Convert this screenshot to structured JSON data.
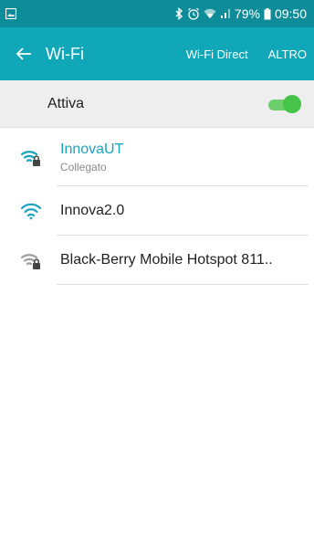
{
  "status_bar": {
    "battery_percent": "79%",
    "time": "09:50",
    "icons": [
      "image-icon",
      "bluetooth-icon",
      "alarm-icon",
      "wifi-status-icon",
      "signal-icon",
      "battery-icon"
    ]
  },
  "app_bar": {
    "title": "Wi-Fi",
    "wifi_direct_label": "Wi-Fi Direct",
    "more_label": "ALTRO"
  },
  "master_switch": {
    "label": "Attiva",
    "on": true
  },
  "networks": [
    {
      "name": "InnovaUT",
      "status": "Collegato",
      "secured": true,
      "connected": true
    },
    {
      "name": "Innova2.0",
      "status": "",
      "secured": false,
      "connected": false
    },
    {
      "name": "Black-Berry Mobile Hotspot 811..",
      "status": "",
      "secured": true,
      "connected": false
    }
  ],
  "colors": {
    "status_bar": "#0e8c99",
    "app_bar": "#10a7b8",
    "accent": "#19a3bf",
    "toggle_on": "#46c44a",
    "wifi_weak": "#9e9e9e"
  }
}
